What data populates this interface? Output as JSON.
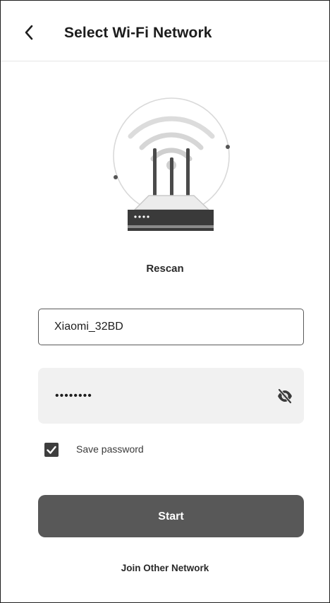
{
  "header": {
    "title": "Select Wi-Fi Network",
    "back_icon": "chevron-left-icon"
  },
  "illustration": {
    "icon": "router-wifi-icon"
  },
  "rescan_label": "Rescan",
  "ssid_field": {
    "value": "Xiaomi_32BD"
  },
  "password_field": {
    "value": "••••••••",
    "visibility_icon": "eye-off-icon"
  },
  "save_password": {
    "label": "Save password",
    "checked": true
  },
  "start_label": "Start",
  "join_other_label": "Join Other Network",
  "colors": {
    "button_bg": "#585858",
    "field_bg": "#f1f1f1",
    "checkbox_bg": "#3e3e3e"
  }
}
